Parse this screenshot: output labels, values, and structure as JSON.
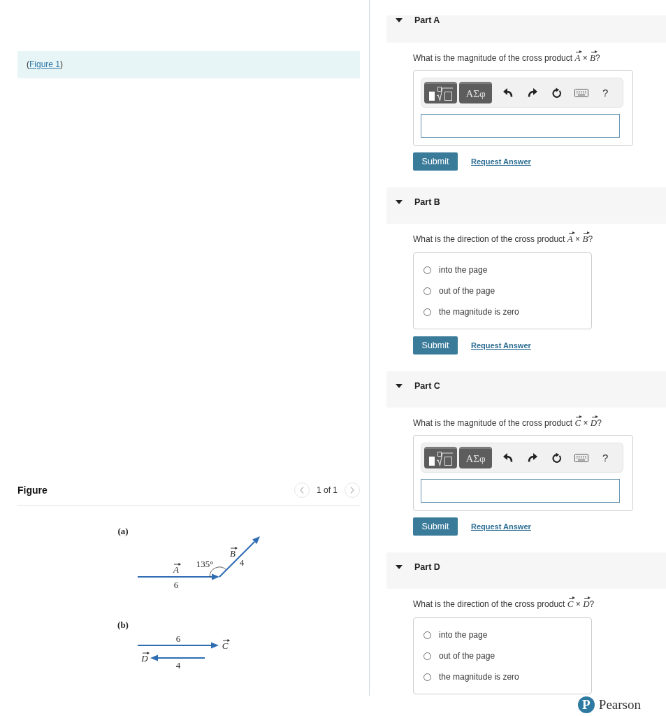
{
  "figure_reference": {
    "before": "(",
    "link": "Figure 1",
    "after": ")"
  },
  "figure": {
    "title": "Figure",
    "pager": "1 of 1",
    "panels": [
      {
        "kind": "angle",
        "label": "(a)",
        "vectors": [
          {
            "symbol": "A",
            "vector": true,
            "magnitude": "6"
          },
          {
            "symbol": "B",
            "vector": true,
            "magnitude": "4"
          }
        ],
        "angle": "135°"
      },
      {
        "kind": "antiparallel",
        "label": "(b)",
        "vectors": [
          {
            "symbol": "C",
            "vector": true,
            "magnitude": "6"
          },
          {
            "symbol": "D",
            "vector": true,
            "magnitude": "4"
          }
        ]
      }
    ]
  },
  "parts": [
    {
      "title": "Part A",
      "expanded": true,
      "question": [
        {
          "kind": "text",
          "text": "What is the magnitude of the cross product "
        },
        {
          "kind": "symbol",
          "text": "A",
          "vector": true
        },
        {
          "kind": "text",
          "text": " × "
        },
        {
          "kind": "symbol",
          "text": "B",
          "vector": true
        },
        {
          "kind": "text",
          "text": "?"
        }
      ],
      "kind": "math",
      "toolbar": {
        "symbols": "ΑΣφ",
        "help": "?"
      },
      "submit": "Submit",
      "request": "Request Answer"
    },
    {
      "title": "Part B",
      "expanded": true,
      "question": [
        {
          "kind": "text",
          "text": "What is the direction of the cross product "
        },
        {
          "kind": "symbol",
          "text": "A",
          "vector": true
        },
        {
          "kind": "text",
          "text": " × "
        },
        {
          "kind": "symbol",
          "text": "B",
          "vector": true
        },
        {
          "kind": "text",
          "text": "?"
        }
      ],
      "kind": "choice",
      "options": [
        {
          "label": "into the page",
          "selected": false
        },
        {
          "label": "out of the page",
          "selected": false
        },
        {
          "label": "the magnitude is zero",
          "selected": false
        }
      ],
      "submit": "Submit",
      "request": "Request Answer"
    },
    {
      "title": "Part C",
      "expanded": true,
      "question": [
        {
          "kind": "text",
          "text": "What is the magnitude of the cross product "
        },
        {
          "kind": "symbol",
          "text": "C",
          "vector": true
        },
        {
          "kind": "text",
          "text": " × "
        },
        {
          "kind": "symbol",
          "text": "D",
          "vector": true
        },
        {
          "kind": "text",
          "text": "?"
        }
      ],
      "kind": "math",
      "toolbar": {
        "symbols": "ΑΣφ",
        "help": "?"
      },
      "submit": "Submit",
      "request": "Request Answer"
    },
    {
      "title": "Part D",
      "expanded": true,
      "question": [
        {
          "kind": "text",
          "text": "What is the direction of the cross product "
        },
        {
          "kind": "symbol",
          "text": "C",
          "vector": true
        },
        {
          "kind": "text",
          "text": " × "
        },
        {
          "kind": "symbol",
          "text": "D",
          "vector": true
        },
        {
          "kind": "text",
          "text": "?"
        }
      ],
      "kind": "choice",
      "options": [
        {
          "label": "into the page",
          "selected": false
        },
        {
          "label": "out of the page",
          "selected": false
        },
        {
          "label": "the magnitude is zero",
          "selected": false
        }
      ]
    }
  ],
  "footer": {
    "logo_mark": "P",
    "brand": "Pearson"
  }
}
